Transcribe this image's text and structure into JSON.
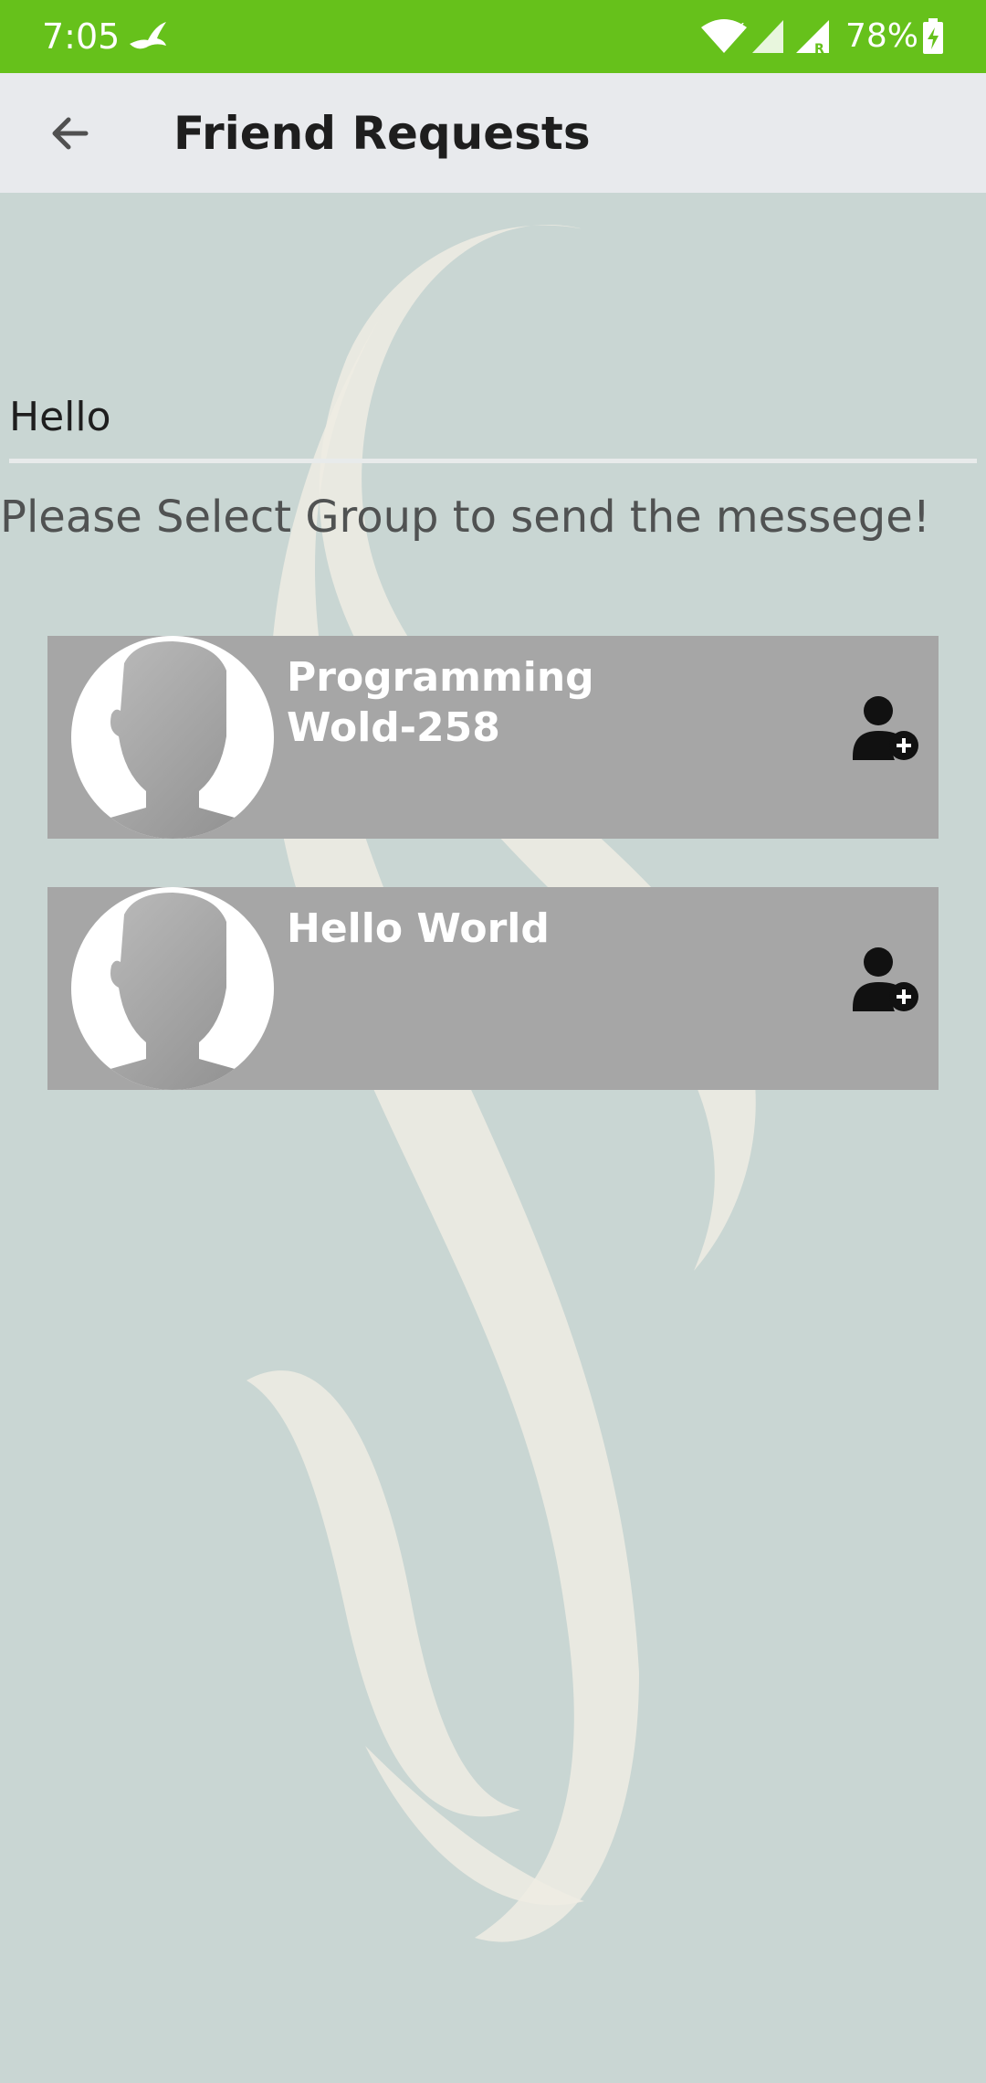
{
  "status_bar": {
    "time": "7:05",
    "battery": "78%",
    "icons": [
      "bird-notification-icon",
      "wifi-icon",
      "cell-signal-icon",
      "roaming-signal-icon",
      "battery-charging-icon"
    ],
    "color": "#66c11b"
  },
  "app_bar": {
    "title": "Friend Requests",
    "back_icon": "arrow-left-icon"
  },
  "message": {
    "value": "Hello"
  },
  "instruction": "Please Select Group to send the messege!",
  "groups": [
    {
      "name": "Programming Wold-258",
      "avatar_icon": "default-avatar-icon",
      "action_icon": "add-person-icon"
    },
    {
      "name": "Hello World",
      "avatar_icon": "default-avatar-icon",
      "action_icon": "add-person-icon"
    }
  ],
  "colors": {
    "card": "#a6a6a6",
    "background": "#c9d6d3",
    "app_bar": "#e8eaed"
  }
}
